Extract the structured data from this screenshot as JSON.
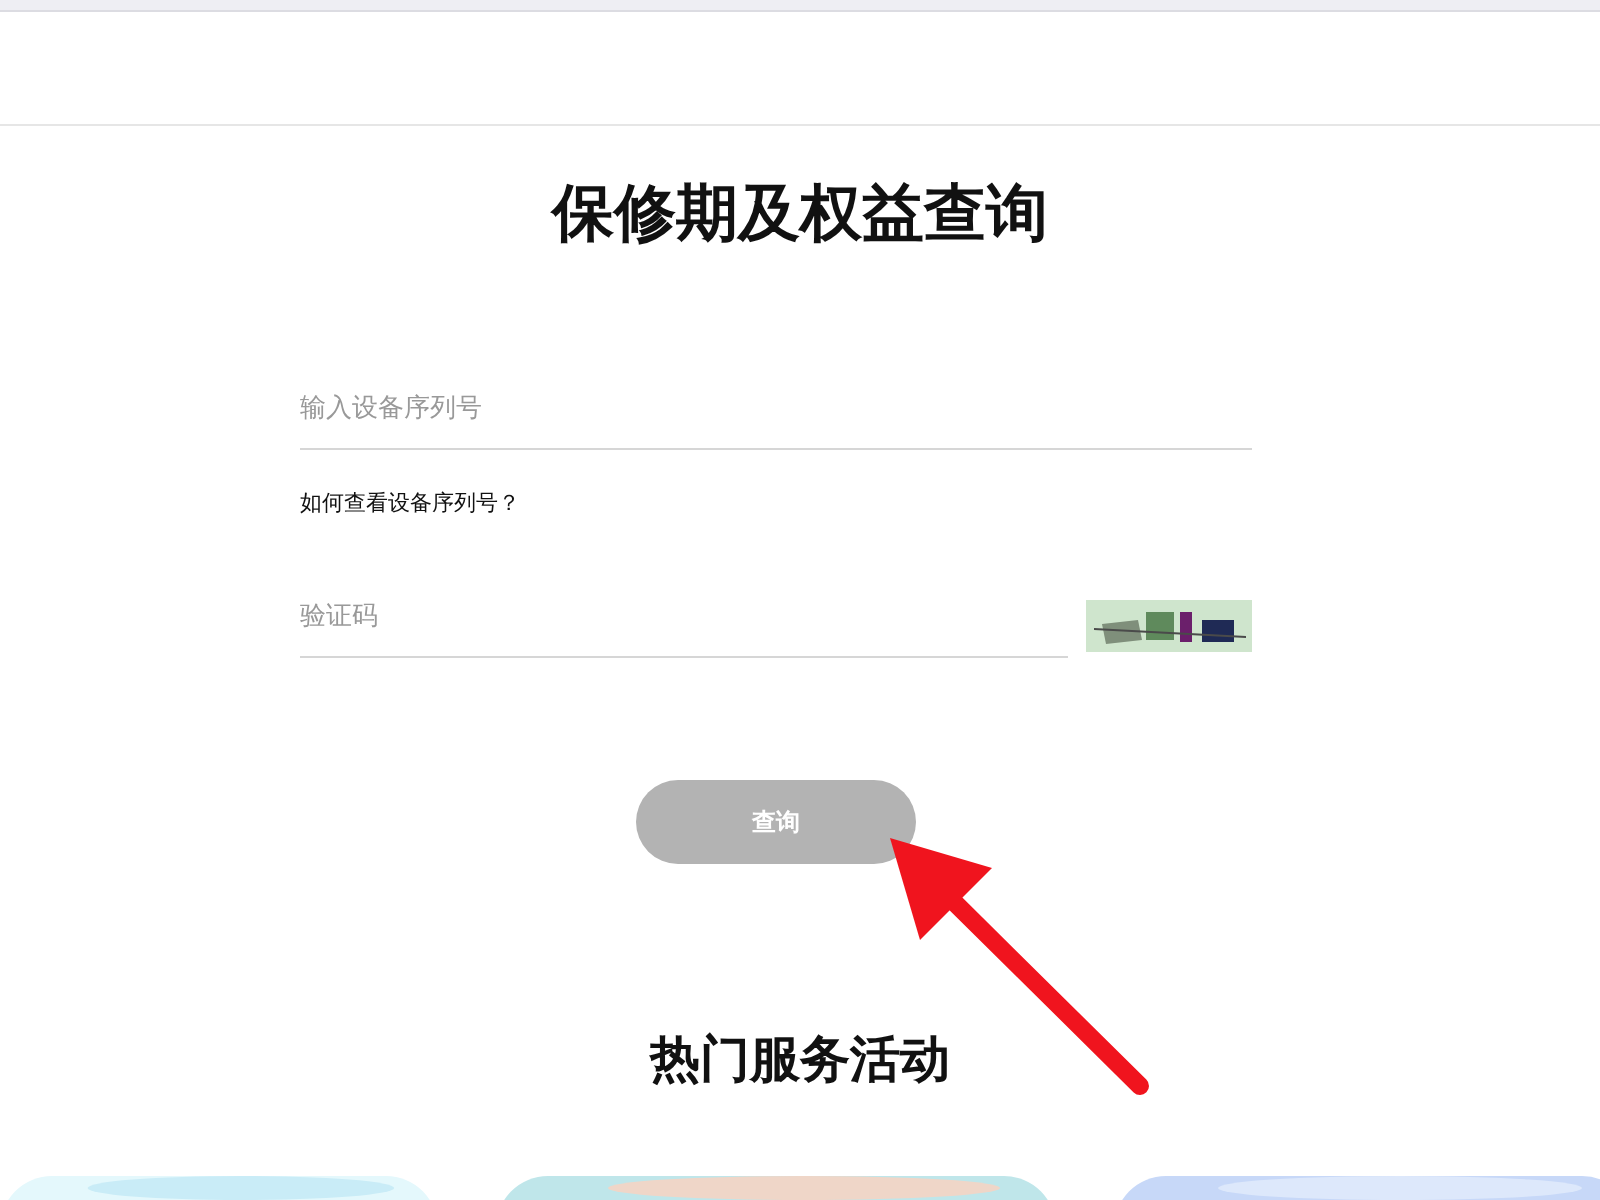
{
  "title": "保修期及权益查询",
  "serial_field": {
    "placeholder": "输入设备序列号"
  },
  "help_link": "如何查看设备序列号？",
  "captcha_field": {
    "placeholder": "验证码"
  },
  "query_button": "查询",
  "section_title": "热门服务活动"
}
